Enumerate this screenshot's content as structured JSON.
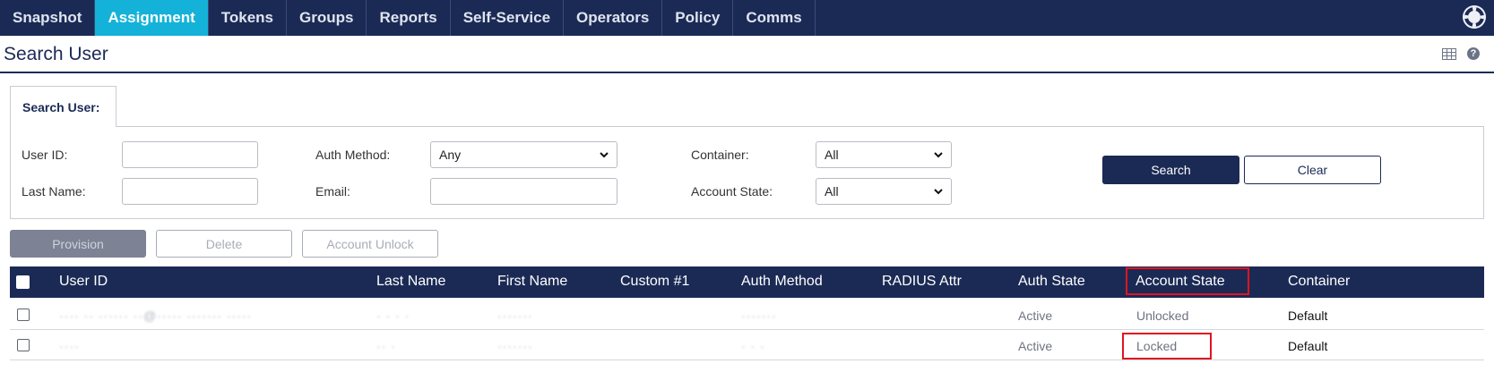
{
  "nav": {
    "tabs": [
      "Snapshot",
      "Assignment",
      "Tokens",
      "Groups",
      "Reports",
      "Self-Service",
      "Operators",
      "Policy",
      "Comms"
    ],
    "active_index": 1,
    "help_icon": "lifebuoy-icon"
  },
  "page": {
    "title": "Search User",
    "icons": [
      "table-icon",
      "help-icon"
    ]
  },
  "search": {
    "tab_label": "Search User:",
    "user_id_label": "User ID:",
    "user_id_value": "",
    "last_name_label": "Last Name:",
    "last_name_value": "",
    "auth_method_label": "Auth Method:",
    "auth_method_value": "Any",
    "email_label": "Email:",
    "email_value": "",
    "container_label": "Container:",
    "container_value": "All",
    "account_state_label": "Account State:",
    "account_state_value": "All",
    "search_button": "Search",
    "clear_button": "Clear"
  },
  "actions": {
    "provision": "Provision",
    "delete": "Delete",
    "unlock": "Account Unlock"
  },
  "table": {
    "headers": [
      "User ID",
      "Last Name",
      "First Name",
      "Custom #1",
      "Auth Method",
      "RADIUS Attr",
      "Auth State",
      "Account State",
      "Container"
    ],
    "rows": [
      {
        "user_id": "···· ·· ······ ··@····· ······· ·····",
        "last_name": "· · · ·",
        "first_name": "·······",
        "custom1": "",
        "auth_method": "·······",
        "radius_attr": "",
        "auth_state": "Active",
        "account_state": "Unlocked",
        "container": "Default"
      },
      {
        "user_id": "····",
        "last_name": "·· ·",
        "first_name": "·······",
        "custom1": "",
        "auth_method": "· · ·",
        "radius_attr": "",
        "auth_state": "Active",
        "account_state": "Locked",
        "container": "Default"
      }
    ]
  },
  "colors": {
    "nav_bg": "#1b2a55",
    "active_tab": "#14b2d8",
    "highlight": "#e0141f"
  }
}
